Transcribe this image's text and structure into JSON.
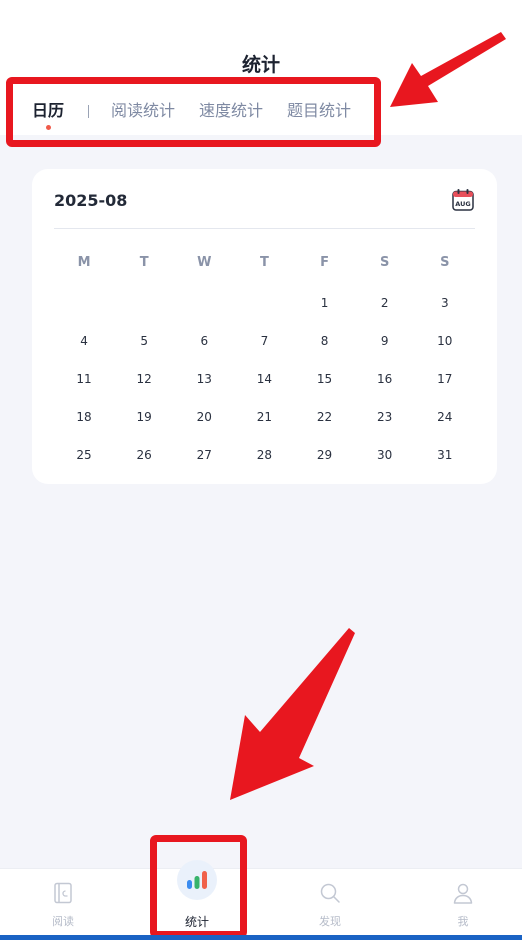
{
  "header": {
    "title": "统计"
  },
  "tabs": [
    {
      "label": "日历",
      "active": true
    },
    {
      "label": "阅读统计",
      "active": false
    },
    {
      "label": "速度统计",
      "active": false
    },
    {
      "label": "题目统计",
      "active": false
    }
  ],
  "calendar": {
    "month": "2025-08",
    "icon_label": "AUG",
    "weekdays": [
      "M",
      "T",
      "W",
      "T",
      "F",
      "S",
      "S"
    ],
    "weeks": [
      [
        "",
        "",
        "",
        "",
        "1",
        "2",
        "3"
      ],
      [
        "4",
        "5",
        "6",
        "7",
        "8",
        "9",
        "10"
      ],
      [
        "11",
        "12",
        "13",
        "14",
        "15",
        "16",
        "17"
      ],
      [
        "18",
        "19",
        "20",
        "21",
        "22",
        "23",
        "24"
      ],
      [
        "25",
        "26",
        "27",
        "28",
        "29",
        "30",
        "31"
      ]
    ]
  },
  "bottom_nav": [
    {
      "label": "阅读",
      "icon": "book-icon",
      "active": false
    },
    {
      "label": "统计",
      "icon": "bar-chart-icon",
      "active": true
    },
    {
      "label": "发现",
      "icon": "search-icon",
      "active": false
    },
    {
      "label": "我",
      "icon": "user-icon",
      "active": false
    }
  ],
  "colors": {
    "annotation": "#e8171f",
    "active_dot": "#f05a4a",
    "background": "#f4f5fa",
    "bottom_strip": "#1a63c4"
  }
}
